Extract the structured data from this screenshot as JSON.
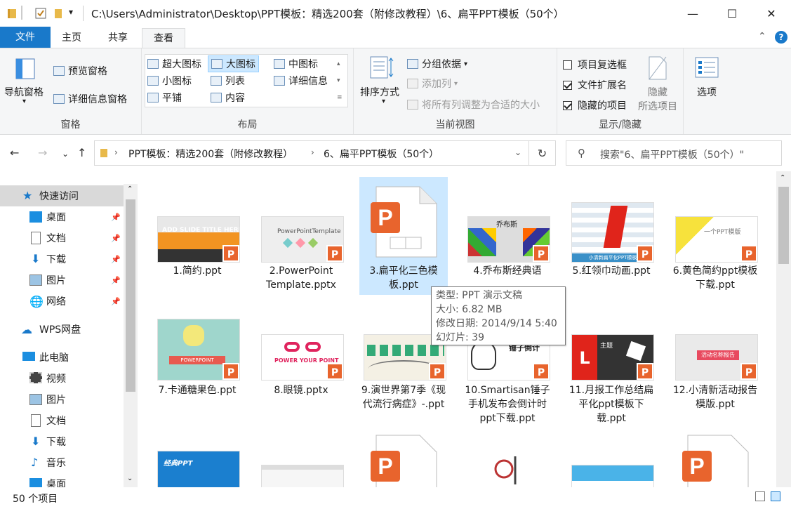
{
  "window": {
    "title": "C:\\Users\\Administrator\\Desktop\\PPT模板：精选200套（附修改教程）\\6、扁平PPT模板（50个）",
    "minimize": "—",
    "maximize": "☐",
    "close": "✕"
  },
  "tabs": {
    "file": "文件",
    "home": "主页",
    "share": "共享",
    "view": "查看"
  },
  "ribbon": {
    "panes": {
      "label": "窗格",
      "nav_pane": "导航窗格",
      "preview_pane": "预览窗格",
      "details_pane": "详细信息窗格"
    },
    "layout": {
      "label": "布局",
      "items": [
        "超大图标",
        "大图标",
        "中图标",
        "小图标",
        "列表",
        "详细信息",
        "平铺",
        "内容"
      ],
      "selected": "大图标"
    },
    "current_view": {
      "label": "当前视图",
      "sort": "排序方式",
      "group_by": "分组依据",
      "add_column": "添加列",
      "fit_columns": "将所有列调整为合适的大小"
    },
    "show_hide": {
      "label": "显示/隐藏",
      "item_checkboxes": "项目复选框",
      "item_checkboxes_checked": false,
      "file_ext": "文件扩展名",
      "file_ext_checked": true,
      "hidden_items": "隐藏的项目",
      "hidden_items_checked": true,
      "hide_selected": "隐藏",
      "hide_selected2": "所选项目",
      "options": "选项"
    }
  },
  "address": {
    "crumbs": [
      "PPT模板：精选200套（附修改教程）",
      "6、扁平PPT模板（50个）"
    ],
    "search_placeholder": "搜索\"6、扁平PPT模板（50个）\""
  },
  "nav": {
    "quick_access": "快速访问",
    "quick_items": [
      "桌面",
      "文档",
      "下载",
      "图片",
      "网络"
    ],
    "wps": "WPS网盘",
    "this_pc": "此电脑",
    "pc_items": [
      "视频",
      "图片",
      "文档",
      "下载",
      "音乐",
      "桌面"
    ]
  },
  "files": [
    {
      "name": "1.简约.ppt"
    },
    {
      "name": "2.PowerPoint Template.pptx"
    },
    {
      "name": "3.扁平化三色模板.ppt"
    },
    {
      "name": "4.乔布斯经典语录.ppt"
    },
    {
      "name": "5.红领巾动画.ppt"
    },
    {
      "name": "6.黄色简约ppt模板下载.ppt"
    },
    {
      "name": "7.卡通糖果色.ppt"
    },
    {
      "name": "8.眼镜.pptx"
    },
    {
      "name": "9.演世界第7季《现代流行病症》-.ppt"
    },
    {
      "name": "10.Smartisan锤子手机发布会倒计时ppt下载.ppt"
    },
    {
      "name": "11.月报工作总结扁平化ppt模板下载.ppt"
    },
    {
      "name": "12.小清新活动报告模版.ppt"
    }
  ],
  "thumb_text": {
    "t1": "ADD SLIDE TITLE HERE",
    "t2": "PowerPointTemplate",
    "t4a": "乔布斯",
    "t5": "小清新扁平化PPT模板",
    "t6": "一个PPT模版",
    "t7": "POWERPOINT",
    "t8": "POWER YOUR POINT",
    "t10": "锤子倒计",
    "t11": "主题",
    "t12": "活动名称报告",
    "t13": "经典PPT"
  },
  "tooltip": {
    "type": "类型: PPT 演示文稿",
    "size": "大小: 6.82 MB",
    "modified": "修改日期: 2014/9/14 5:40",
    "slides": "幻灯片: 39"
  },
  "status": {
    "count": "50 个项目"
  },
  "badge_letter": "P",
  "colors": {
    "accent": "#1979ca",
    "ppt_orange": "#e8642d",
    "selected": "#cce8ff"
  }
}
